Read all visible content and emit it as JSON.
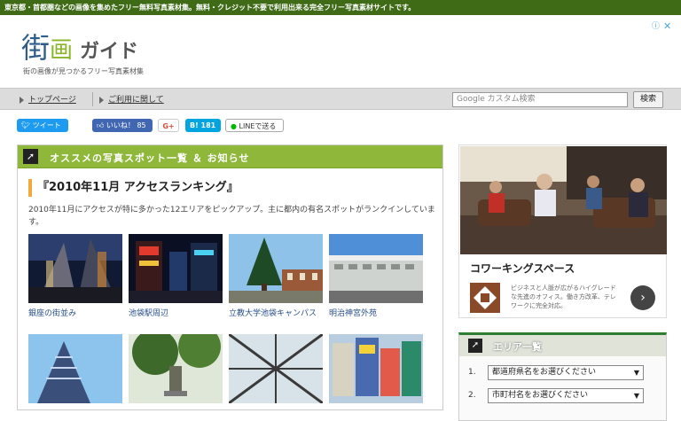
{
  "topbar": {
    "text": "東京都・首都圏などの画像を集めたフリー無料写真素材集。無料・クレジット不要で利用出来る完全フリー写真素材サイトです。"
  },
  "logo": {
    "main_a": "街",
    "main_b": "画",
    "main_c": "ガイド",
    "subtitle": "街の画像が見つかるフリー写真素材集"
  },
  "ad_controls": {
    "info": "ⓘ",
    "close": "✕"
  },
  "nav": {
    "items": [
      {
        "label": "トップページ"
      },
      {
        "label": "ご利用に関して"
      }
    ],
    "search_placeholder": "Google カスタム検索",
    "search_button": "検索"
  },
  "share": {
    "tweet": "ツイート",
    "like": "いいね！ 85",
    "gplus": "G+",
    "hatena": "B! 181",
    "line": "LINEで送る"
  },
  "main": {
    "panel_title": "オススメの写真スポット一覧 ＆ お知らせ",
    "article_title": "『2010年11月 アクセスランキング』",
    "article_desc": "2010年11月にアクセスが特に多かった12エリアをピックアップ。主に都内の有名スポットがランクインしています。",
    "photos": [
      {
        "caption": "銀座の街並み"
      },
      {
        "caption": "池袋駅周辺"
      },
      {
        "caption": "立教大学池袋キャンパス"
      },
      {
        "caption": "明治神宮外苑"
      }
    ]
  },
  "sidebar": {
    "ad_title": "コワーキングスペース",
    "ad_text": "ビジネスと人脈が広がるハイグレードな先進のオフィス。働き方改革、テレワークに完全対応。",
    "ad_arrow": "›",
    "area_title": "エリア一覧",
    "area_rows": [
      {
        "num": "1.",
        "label": "都道府県名をお選びください"
      },
      {
        "num": "2.",
        "label": "市町村名をお選びください"
      }
    ]
  },
  "colors": {
    "topbar": "#3f6b17",
    "panel_head": "#8fb83a",
    "accent": "#f2a93b",
    "link": "#2a4f8a"
  }
}
